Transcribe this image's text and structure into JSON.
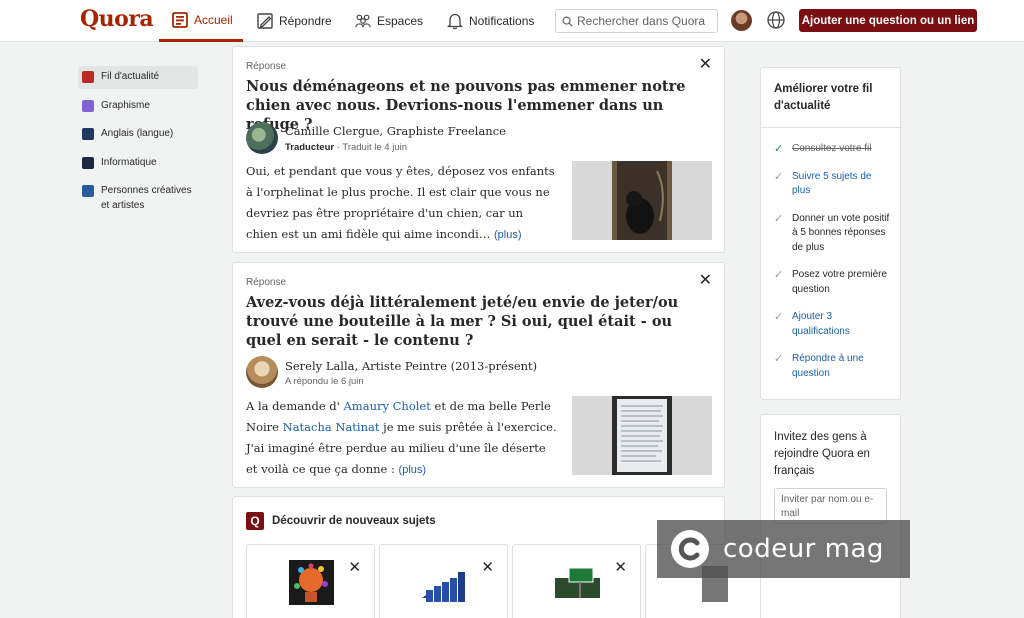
{
  "header": {
    "logo": "Quora",
    "nav": {
      "home": "Accueil",
      "answer": "Répondre",
      "spaces": "Espaces",
      "notifications": "Notifications"
    },
    "search_placeholder": "Rechercher dans Quora",
    "add_button": "Ajouter une question ou un lien"
  },
  "sidebar": {
    "items": [
      {
        "label": "Fil d'actualité",
        "color": "#b92b27"
      },
      {
        "label": "Graphisme",
        "color": "#7d63d6"
      },
      {
        "label": "Anglais (langue)",
        "color": "#1c3a60"
      },
      {
        "label": "Informatique",
        "color": "#1c2a3f"
      },
      {
        "label": "Personnes créatives et artistes",
        "color": "#2a5b9a"
      }
    ]
  },
  "feed": {
    "post1": {
      "label": "Réponse",
      "question": "Nous déménageons et ne pouvons pas emmener notre chien avec nous. Devrions-nous l'emmener dans un refuge ?",
      "author": "Camille Clergue, Graphiste Freelance",
      "role": "Traducteur",
      "date": "· Traduit le 4 juin",
      "body": "Oui, et pendant que vous y êtes, déposez vos enfants à l'orphelinat le plus proche. Il est clair que vous ne devriez pas être propriétaire d'un chien, car un chien est un ami fidèle qui aime incondi…",
      "more": "(plus)"
    },
    "post2": {
      "label": "Réponse",
      "question": "Avez-vous déjà littéralement jeté/eu envie de jeter/ou trouvé une bouteille à la mer ? Si oui, quel était - ou quel en serait - le contenu ?",
      "author": "Serely Lalla, Artiste Peintre (2013-présent)",
      "date": "A répondu le 6 juin",
      "body_a": "A la demande d' ",
      "link1": "Amaury Cholet",
      "body_b": " et de ma belle Perle Noire ",
      "link2": "Natacha Natinat",
      "body_c": " je me suis prêtée à l'exercice. J'ai imaginé être perdue au milieu d'une île déserte et voilà ce que ça donne : ",
      "more": "(plus)"
    },
    "discover": {
      "logo": "Q",
      "title": "Découvrir de nouveaux sujets"
    }
  },
  "right": {
    "improve_title": "Améliorer votre fil d'actualité",
    "tasks": [
      {
        "text": "Consultez votre fil",
        "state": "done"
      },
      {
        "text": "Suivre 5 sujets de plus",
        "state": "blue"
      },
      {
        "text": "Donner un vote positif à 5 bonnes réponses de plus",
        "state": "plain"
      },
      {
        "text": "Posez votre première question",
        "state": "plain"
      },
      {
        "text": "Ajouter 3 qualifications",
        "state": "blue"
      },
      {
        "text": "Répondre à une question",
        "state": "blue"
      }
    ],
    "invite_title": "Invitez des gens à rejoindre Quora en français",
    "invite_placeholder": "Inviter par nom ou e-mail"
  },
  "watermark": "codeur mag",
  "close_glyph": "✕",
  "check_glyph": "✓"
}
